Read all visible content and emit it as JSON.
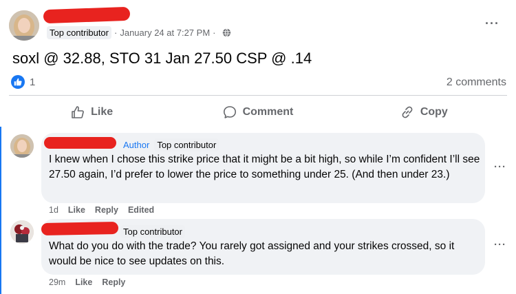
{
  "post": {
    "badge": "Top contributor",
    "date": "January 24 at 7:27 PM",
    "separator": "·",
    "text": "soxl @ 32.88, STO 31 Jan 27.50 CSP @ .14",
    "more": "···",
    "reaction_count": "1",
    "comments_count": "2 comments",
    "actions": {
      "like": "Like",
      "comment": "Comment",
      "copy": "Copy"
    }
  },
  "comments": [
    {
      "author_tag": "Author",
      "badge": "Top contributor",
      "text": "I knew when I chose this strike price that it might be a bit high, so while I’m confident I’ll see 27.50 again, I’d prefer to lower the price to something under 25. (And then under 23.)",
      "time": "1d",
      "like": "Like",
      "reply": "Reply",
      "edited": "Edited",
      "more": "···"
    },
    {
      "badge": "Top contributor",
      "text": "What do you do with the trade? You rarely got assigned and your strikes crossed, so it would be nice to see updates on this.",
      "time": "29m",
      "like": "Like",
      "reply": "Reply",
      "more": "···"
    }
  ],
  "colors": {
    "accent": "#1877f2",
    "redaction": "#e8231f",
    "bubble": "#f0f2f5",
    "secondary_text": "#65676b"
  },
  "icons": {
    "like_bubble": "thumbs-up-icon",
    "audience": "globe-icon",
    "like": "thumbs-up-outline-icon",
    "comment": "speech-bubble-icon",
    "copy": "link-icon"
  }
}
